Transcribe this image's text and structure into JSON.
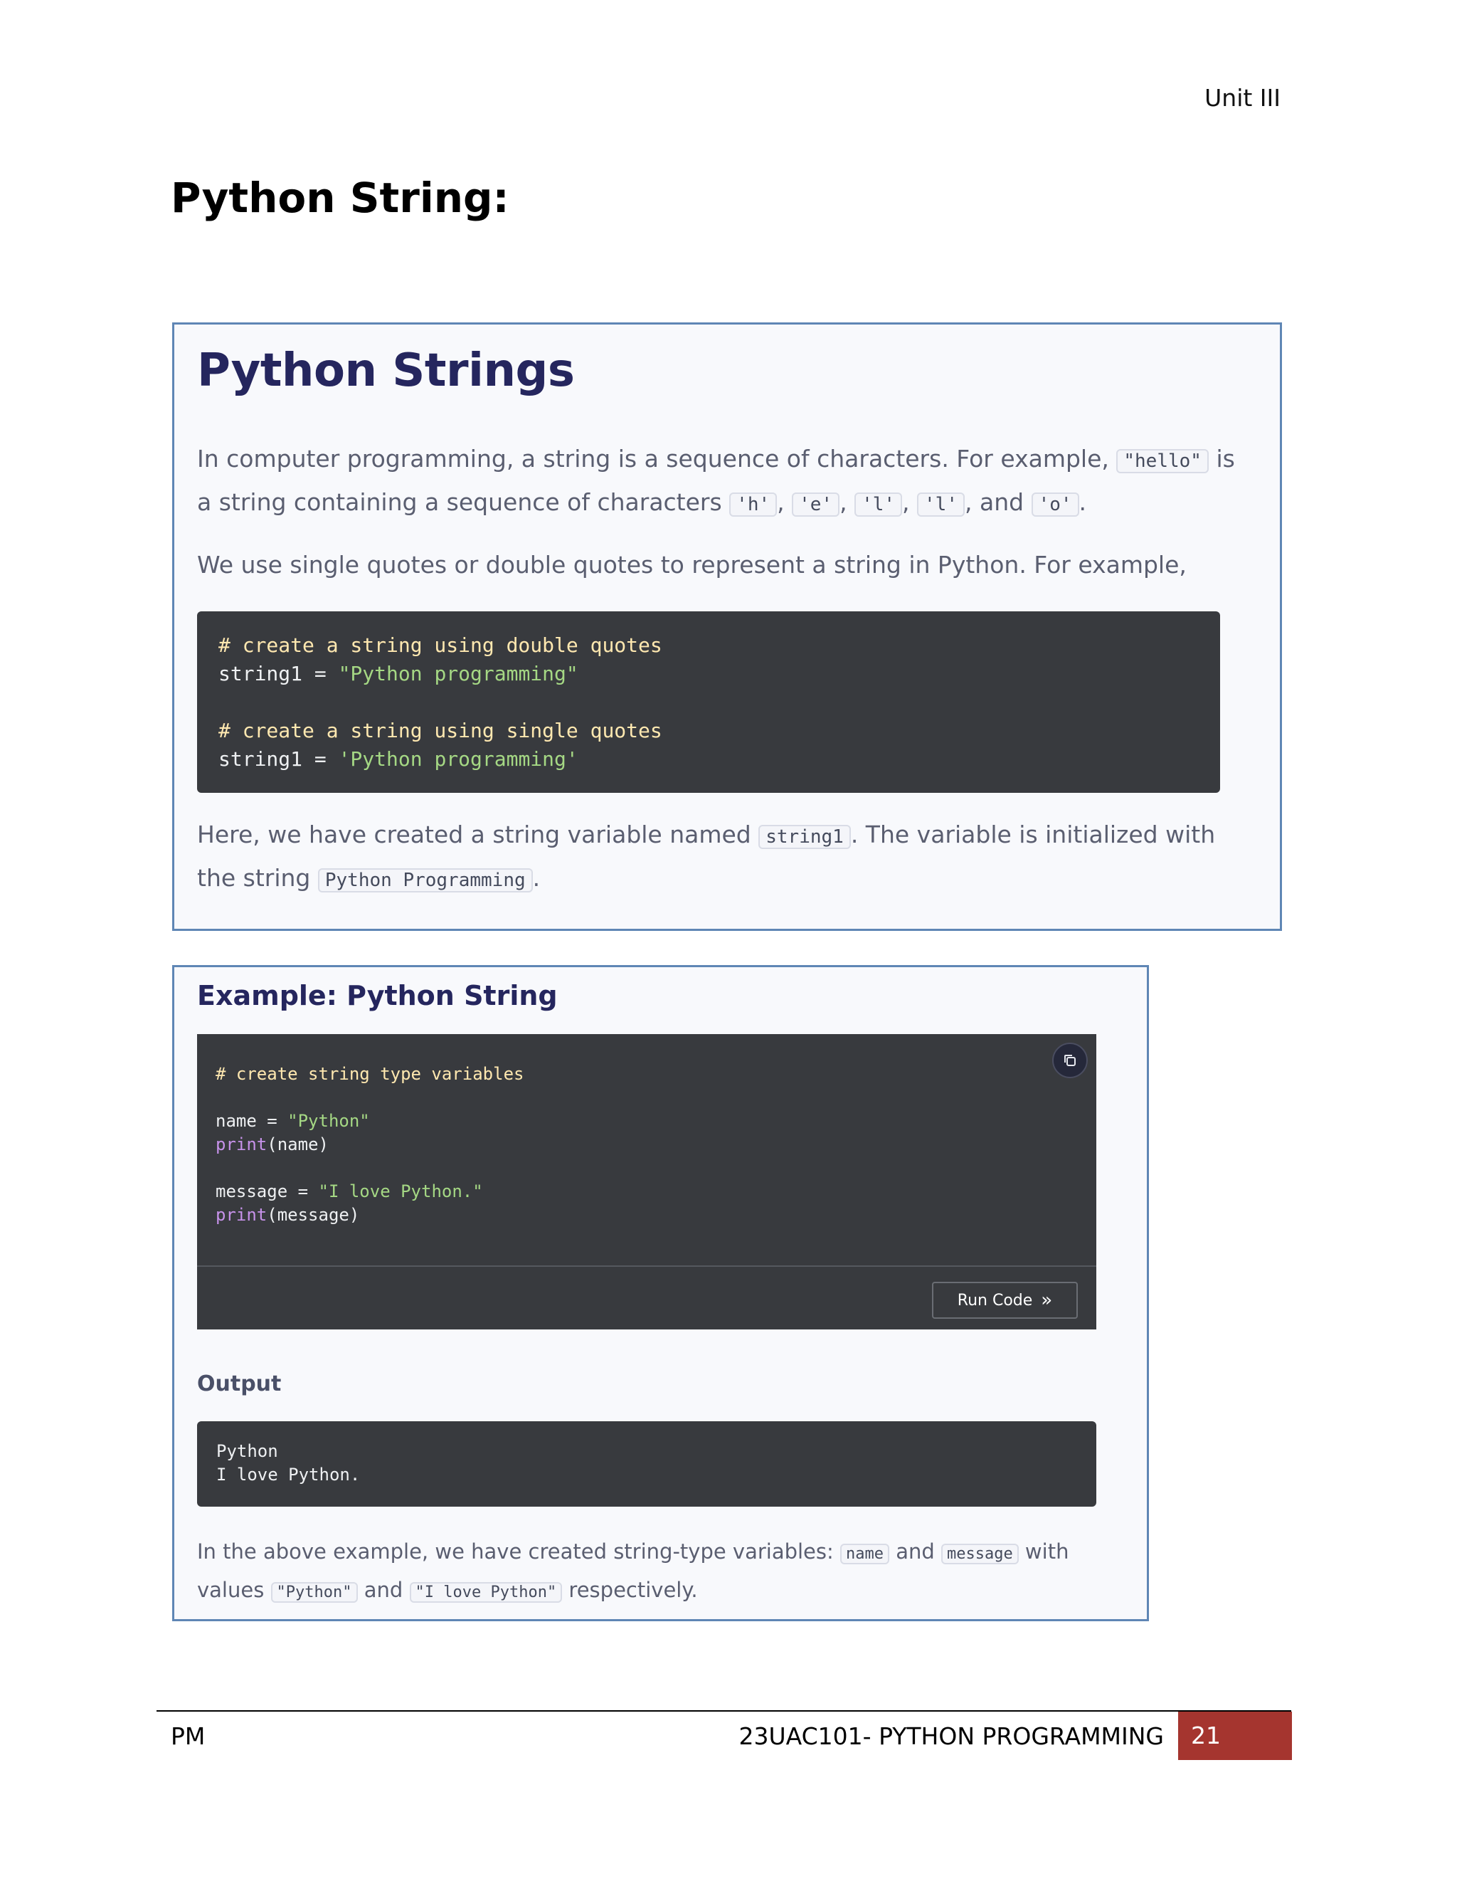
{
  "header": {
    "unit": "Unit III"
  },
  "page_title": "Python String:",
  "panel1": {
    "heading": "Python Strings",
    "p1": {
      "t1": "In computer programming, a string is a sequence of characters. For example, ",
      "c1": "\"hello\"",
      "t2": " is a string containing a sequence of characters ",
      "c2": "'h'",
      "s1": ", ",
      "c3": "'e'",
      "s2": ", ",
      "c4": "'l'",
      "s3": ", ",
      "c5": "'l'",
      "s4": ", and ",
      "c6": "'o'",
      "s5": "."
    },
    "p2": "We use single quotes or double quotes to represent a string in Python. For example,",
    "code": {
      "comment1": "# create a string using double quotes",
      "line1_var": "string1 = ",
      "line1_str": "\"Python programming\"",
      "comment2": "# create a string using single quotes",
      "line2_var": "string1 = ",
      "line2_str": "'Python programming'"
    },
    "p3": {
      "t1": "Here, we have created a string variable named ",
      "c1": "string1",
      "t2": ". The variable is initialized with the string ",
      "c2": "Python Programming",
      "t3": "."
    }
  },
  "panel2": {
    "heading": "Example: Python String",
    "code": {
      "comment": "# create string type variables",
      "l1_var": "name = ",
      "l1_str": "\"Python\"",
      "l2_fn": "print",
      "l2_rest": "(name)",
      "l3_var": "message = ",
      "l3_str": "\"I love Python.\"",
      "l4_fn": "print",
      "l4_rest": "(message)"
    },
    "run_button": "Run Code",
    "run_icon": "»",
    "output_label": "Output",
    "output_lines": {
      "l1": "Python",
      "l2": "I love Python."
    },
    "p": {
      "t1": "In the above example, we have created string-type variables: ",
      "c1": "name",
      "t2": " and ",
      "c2": "message",
      "t3": " with values ",
      "c3": "\"Python\"",
      "t4": " and ",
      "c4": "\"I love Python\"",
      "t5": " respectively."
    }
  },
  "footer": {
    "left": "PM",
    "course": "23UAC101- PYTHON PROGRAMMING",
    "page": "21"
  },
  "colors": {
    "footer_accent": "#a5352f",
    "panel_border": "#5f86b5",
    "heading": "#25265e",
    "code_bg": "#383a3e"
  }
}
